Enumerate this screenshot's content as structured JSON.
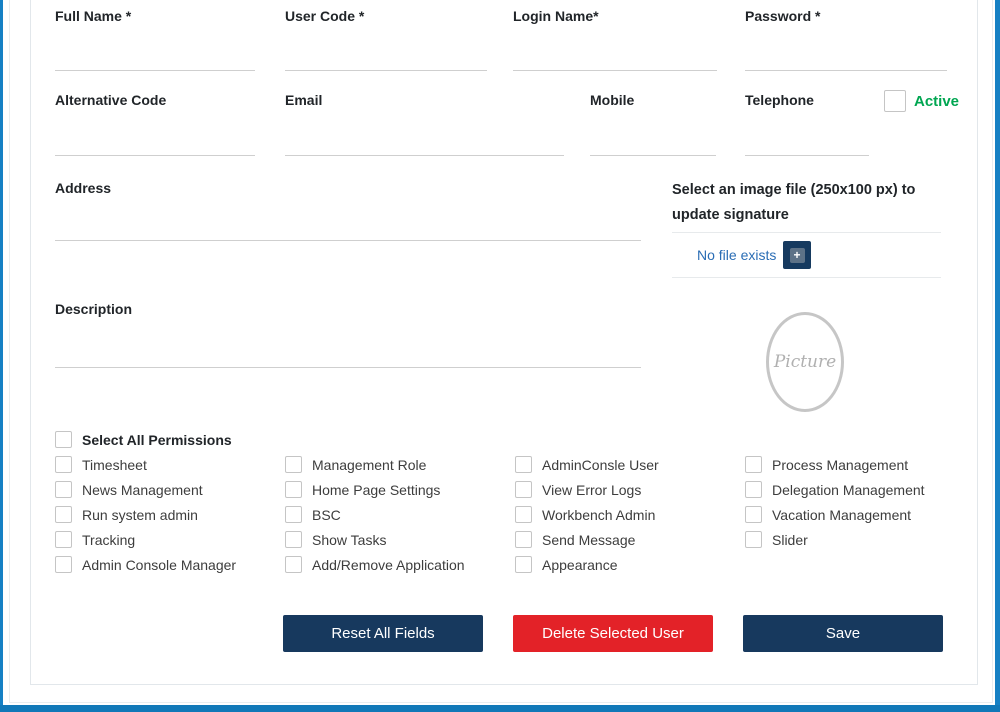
{
  "form": {
    "fields": {
      "full_name": {
        "label": "Full Name *",
        "value": ""
      },
      "user_code": {
        "label": "User Code *",
        "value": ""
      },
      "login_name": {
        "label": "Login Name*",
        "value": ""
      },
      "password": {
        "label": "Password *",
        "value": ""
      },
      "alternative_code": {
        "label": "Alternative Code",
        "value": ""
      },
      "email": {
        "label": "Email",
        "value": ""
      },
      "mobile": {
        "label": "Mobile",
        "value": ""
      },
      "telephone": {
        "label": "Telephone",
        "value": ""
      },
      "address": {
        "label": "Address",
        "value": ""
      },
      "description": {
        "label": "Description",
        "value": ""
      }
    },
    "active_checkbox": {
      "label": "Active"
    }
  },
  "signature": {
    "instruction": "Select an image file (250x100 px) to update signature",
    "file_status": "No file exists",
    "add_button": "+"
  },
  "picture_placeholder": "Picture",
  "permissions": {
    "select_all_label": "Select All Permissions",
    "columns": [
      {
        "items": [
          "Timesheet",
          "News Management",
          "Run system admin",
          "Tracking",
          "Admin Console Manager"
        ]
      },
      {
        "items": [
          "Management Role",
          "Home Page Settings",
          "BSC",
          "Show Tasks",
          "Add/Remove Application"
        ]
      },
      {
        "items": [
          "AdminConsle User",
          "View Error Logs",
          "Workbench Admin",
          "Send Message",
          "Appearance"
        ]
      },
      {
        "items": [
          "Process Management",
          "Delegation Management",
          "Vacation Management",
          "Slider"
        ]
      }
    ]
  },
  "actions": {
    "reset": "Reset All Fields",
    "delete": "Delete Selected User",
    "save": "Save"
  },
  "colors": {
    "navy": "#17395e",
    "red": "#e32228",
    "green": "#00a651",
    "link_blue": "#2a6db5",
    "frame_blue": "#1680c4"
  }
}
